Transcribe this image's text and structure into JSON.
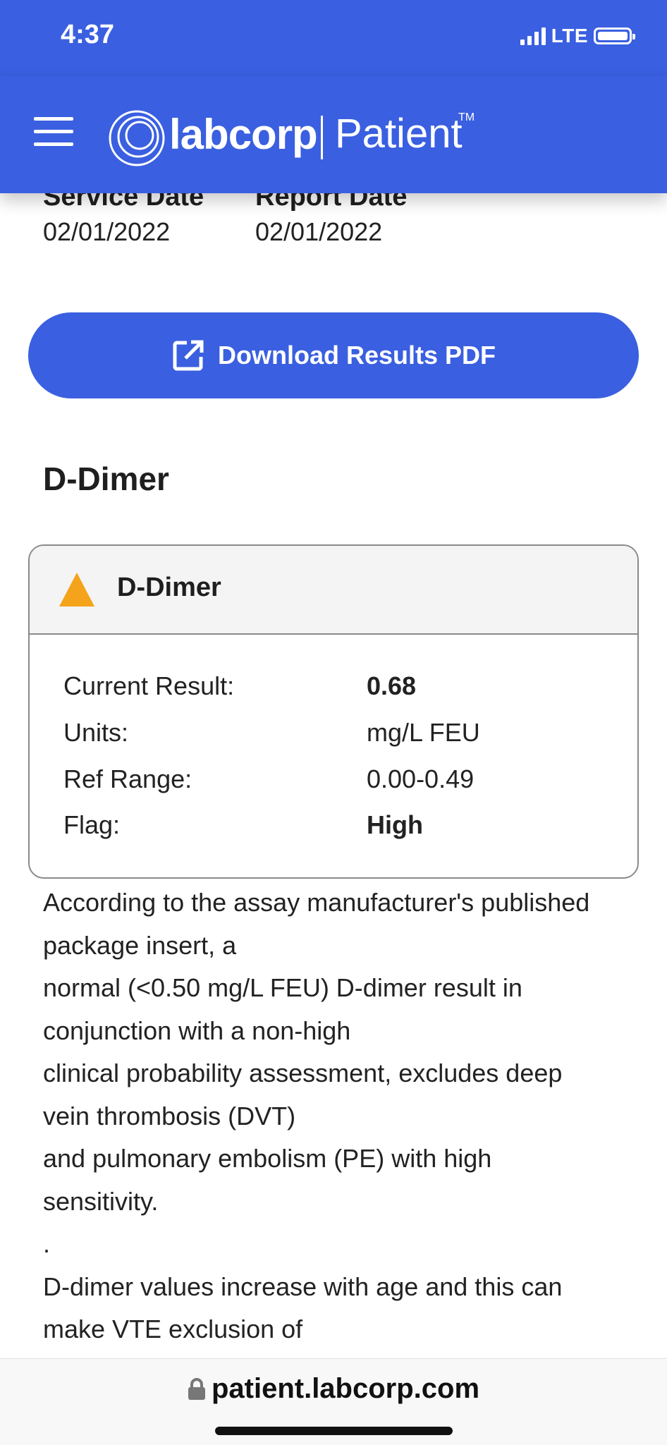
{
  "status_bar": {
    "time": "4:37",
    "network": "LTE"
  },
  "header": {
    "brand": "labcorp",
    "product": "Patient",
    "tm": "TM"
  },
  "dates": [
    {
      "label": "Service Date",
      "value": "02/01/2022"
    },
    {
      "label": "Report Date",
      "value": "02/01/2022"
    }
  ],
  "download_button": {
    "label": "Download Results PDF"
  },
  "section": {
    "title": "D-Dimer"
  },
  "result_card": {
    "title": "D-Dimer",
    "rows": [
      {
        "label": "Current Result:",
        "value": "0.68"
      },
      {
        "label": "Units:",
        "value": "mg/L FEU"
      },
      {
        "label": "Ref Range:",
        "value": "0.00-0.49"
      },
      {
        "label": "Flag:",
        "value": "High"
      }
    ],
    "colors": {
      "warning": "#f5a31a"
    }
  },
  "note": {
    "lines": [
      "According to the assay manufacturer's published",
      "package insert, a",
      "normal (<0.50 mg/L FEU) D-dimer result in",
      "conjunction with a non-high",
      "clinical probability assessment, excludes deep",
      "vein thrombosis (DVT)",
      "and pulmonary embolism (PE) with high",
      "sensitivity.",
      ".",
      "D-dimer values increase with age and this can",
      "make VTE exclusion of"
    ]
  },
  "browser": {
    "url": "patient.labcorp.com"
  },
  "colors": {
    "brand": "#3a5fe0"
  }
}
